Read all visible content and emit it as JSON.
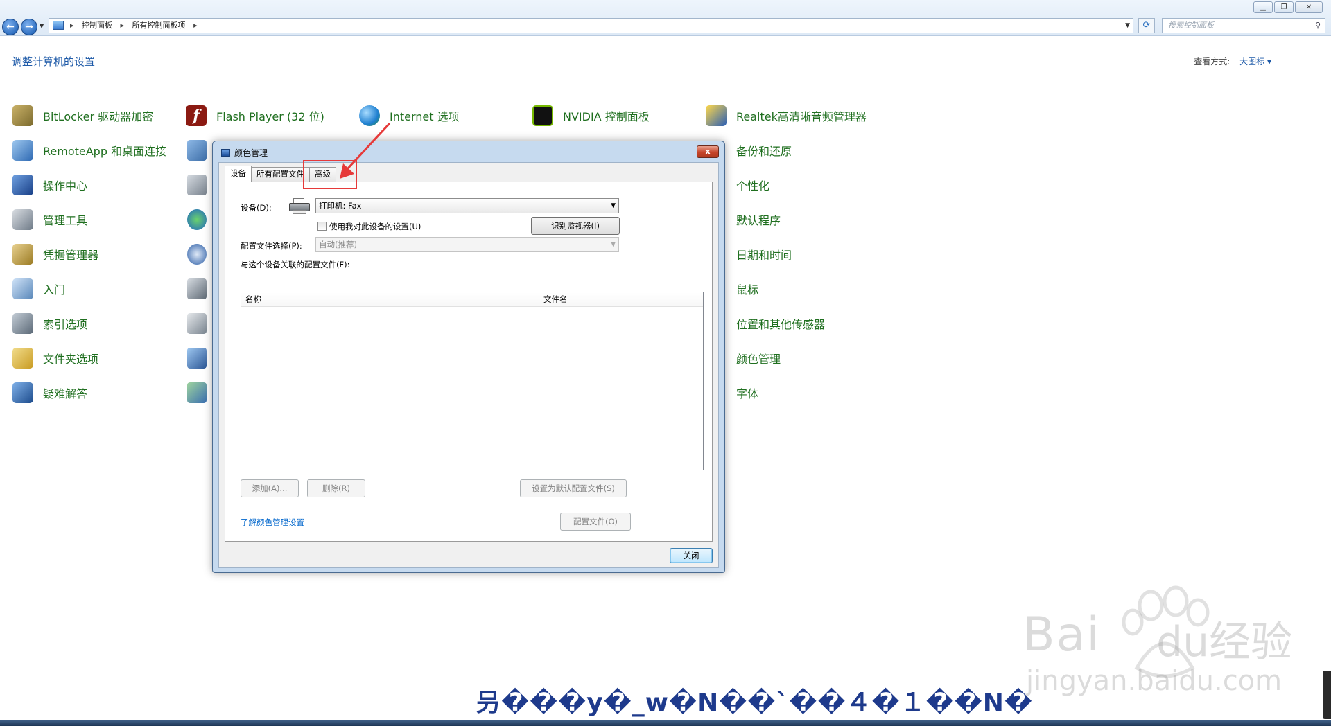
{
  "explorer": {
    "breadcrumb": [
      "控制面板",
      "所有控制面板项"
    ],
    "search_placeholder": "搜索控制面板",
    "page_title": "调整计算机的设置",
    "view_by_label": "查看方式:",
    "view_by_value": "大图标 ▾"
  },
  "items": {
    "col1": [
      "BitLocker 驱动器加密",
      "RemoteApp 和桌面连接",
      "操作中心",
      "管理工具",
      "凭据管理器",
      "入门",
      "索引选项",
      "文件夹选项",
      "疑难解答"
    ],
    "row1": [
      "Flash Player (32 位)",
      "Internet 选项",
      "NVIDIA 控制面板",
      "Realtek高清晰音频管理器"
    ],
    "col5": [
      "备份和还原",
      "个性化",
      "默认程序",
      "日期和时间",
      "鼠标",
      "位置和其他传感器",
      "颜色管理",
      "字体"
    ]
  },
  "dialog": {
    "title": "颜色管理",
    "close_glyph": "x",
    "tabs": [
      "设备",
      "所有配置文件",
      "高级"
    ],
    "device_label": "设备(D):",
    "device_value": "打印机: Fax",
    "use_my_settings": "使用我对此设备的设置(U)",
    "identify_monitors": "识别监视器(I)",
    "profile_selection_label": "配置文件选择(P):",
    "profile_selection_value": "自动(推荐)",
    "associated_profiles_label": "与这个设备关联的配置文件(F):",
    "columns": [
      "名称",
      "文件名"
    ],
    "add_button": "添加(A)...",
    "remove_button": "删除(R)",
    "set_default_button": "设置为默认配置文件(S)",
    "learn_link": "了解颜色管理设置",
    "profiles_button": "配置文件(O)",
    "close_button": "关闭"
  },
  "watermark": {
    "brand": "Bai",
    "brand2": "du经验",
    "url": "jingyan.baidu.com"
  },
  "caption": "叧���y�_w�N��`��４�１��N�"
}
